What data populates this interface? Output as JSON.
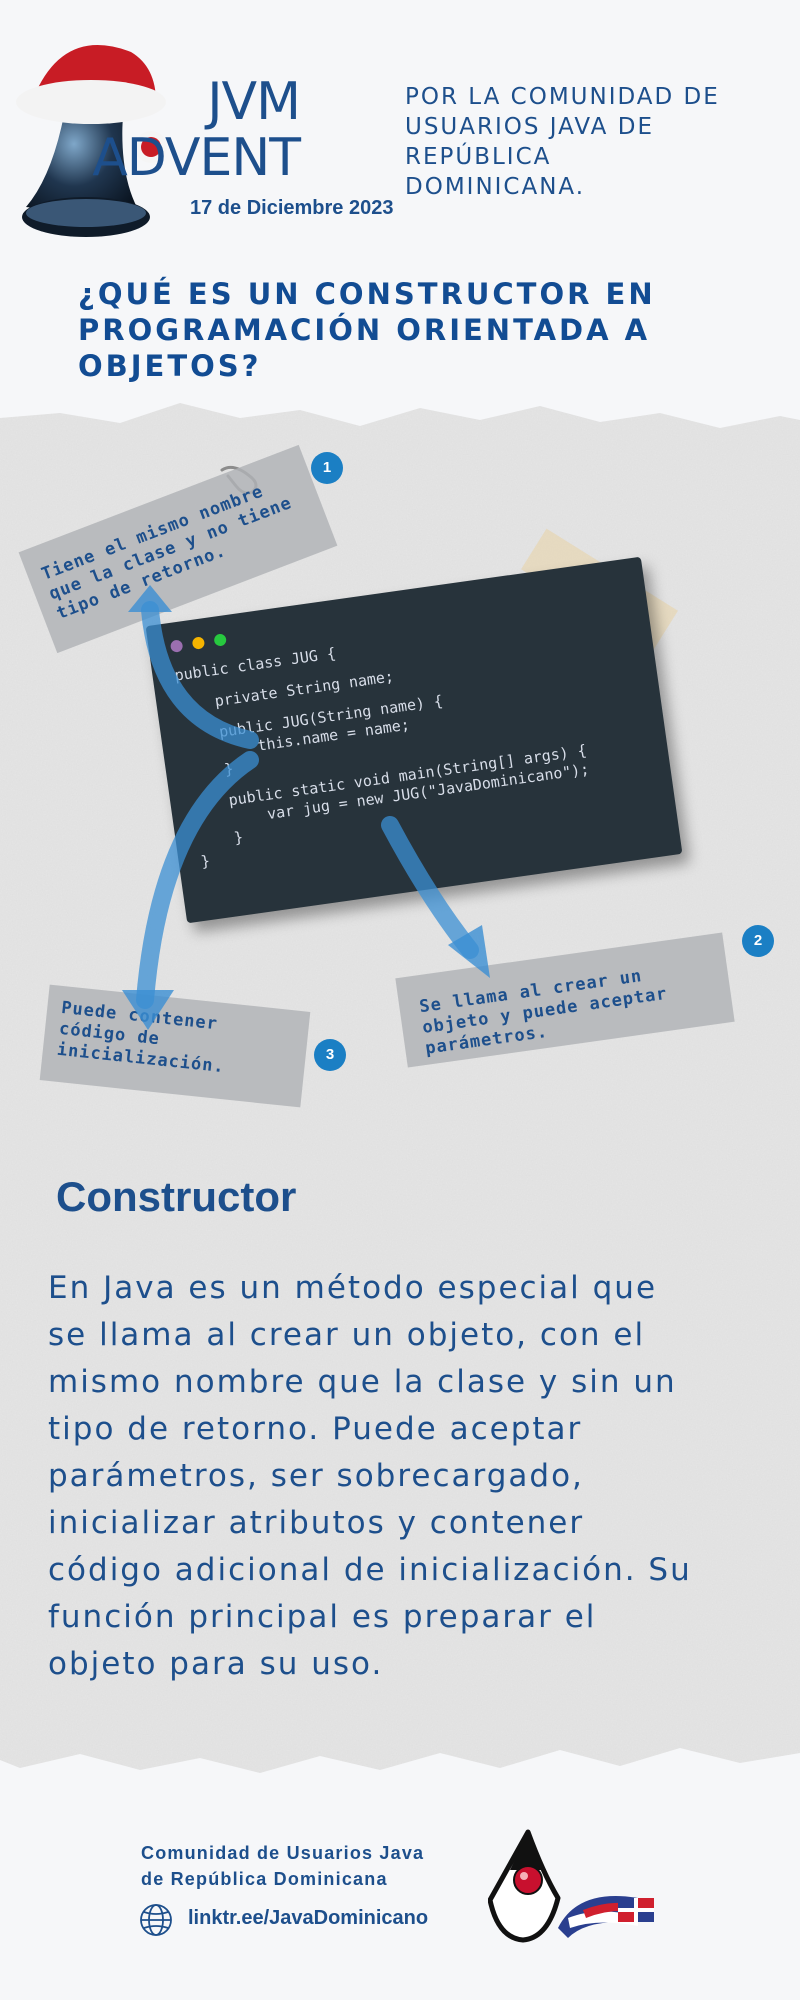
{
  "header": {
    "title_line1": "JVM",
    "title_line2": "ADVENT",
    "date": "17 de Diciembre 2023",
    "subtitle": "POR LA COMUNIDAD DE USUARIOS JAVA DE REPÚBLICA DOMINICANA.",
    "bell_icon": "christmas-bell-icon"
  },
  "question": "¿QUÉ ES UN CONSTRUCTOR EN PROGRAMACIÓN ORIENTADA A OBJETOS?",
  "notes": [
    {
      "number": "1",
      "text": "Tiene el mismo nombre que la clase y no tiene tipo de retorno."
    },
    {
      "number": "2",
      "text": "Se llama al crear un objeto y puede aceptar parámetros."
    },
    {
      "number": "3",
      "text": "Puede contener código de inicialización."
    }
  ],
  "code": {
    "window_dots": [
      "#9b6fb0",
      "#f5b400",
      "#27c93f"
    ],
    "lines": [
      "public class JUG {",
      "    private String name;",
      "    public JUG(String name) {",
      "        this.name = name;",
      "    }",
      "    public static void main(String[] args) {",
      "        var jug = new JUG(\"JavaDominicano\");",
      "    }",
      "}"
    ]
  },
  "section_title": "Constructor",
  "section_body": "En Java es un método especial que se llama al crear un objeto, con el mismo nombre que la clase y sin un tipo de retorno. Puede aceptar parámetros, ser sobrecargado, inicializar atributos y contener código adicional de inicialización. Su función principal es preparar el objeto para su uso.",
  "footer": {
    "org_line1": "Comunidad de Usuarios Java",
    "org_line2": "de República Dominicana",
    "link": "linktr.ee/JavaDominicano",
    "globe_icon": "globe-icon",
    "logo": "java-duke-dominican-flag-logo"
  },
  "colors": {
    "brand_blue": "#1d4f8c",
    "badge_blue": "#1b7fc4",
    "code_bg": "#27333b"
  }
}
